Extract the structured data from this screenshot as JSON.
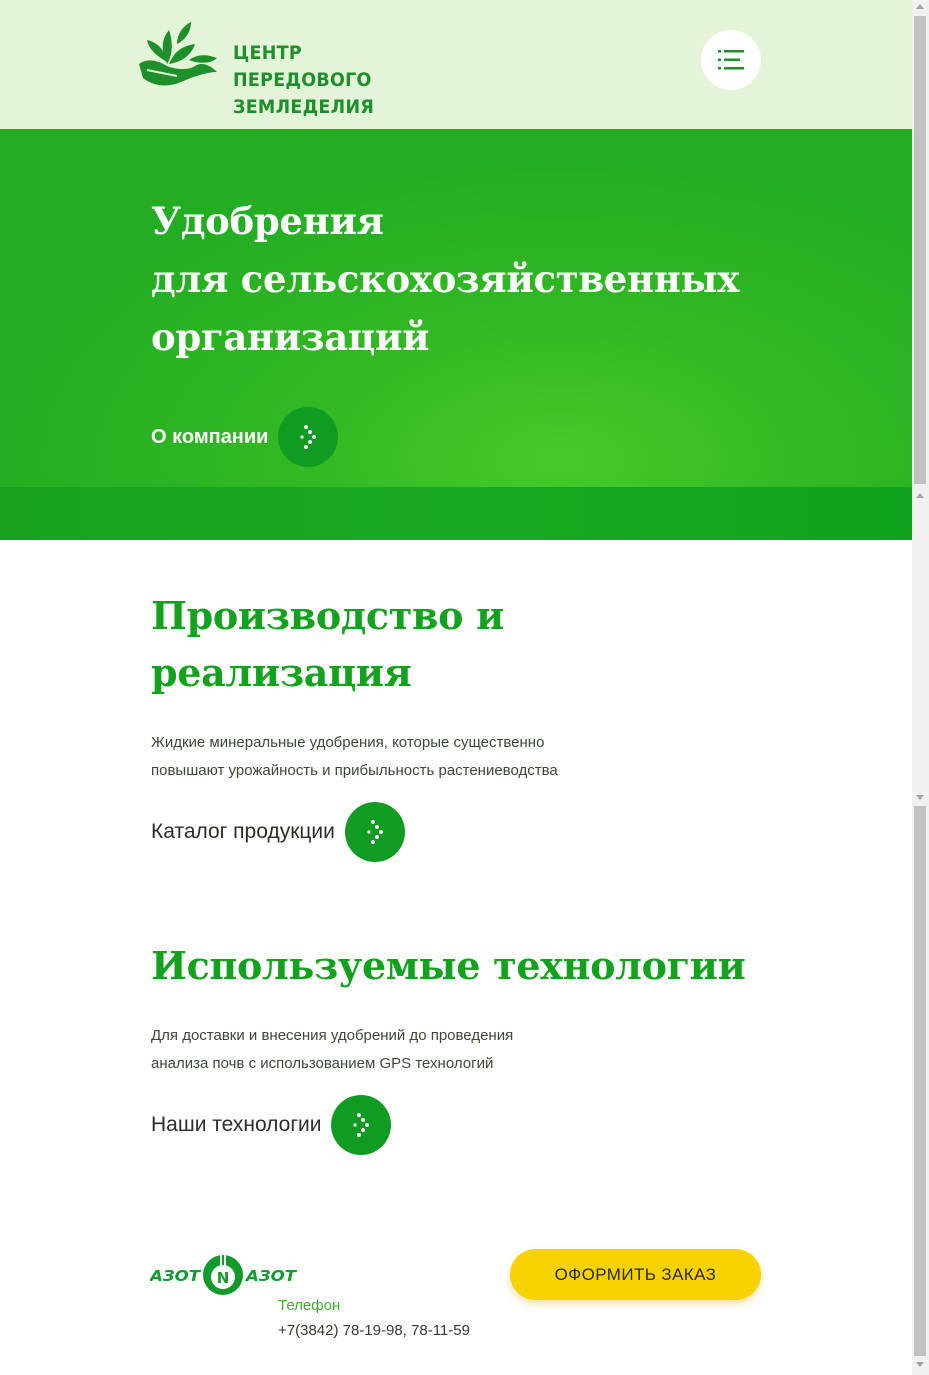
{
  "header": {
    "logo_line1": "ЦЕНТР ПЕРЕДОВОГО",
    "logo_line2": "ЗЕМЛЕДЕЛИЯ",
    "logo_icon": "leaves-hand-icon",
    "menu_icon": "menu-list-icon"
  },
  "hero": {
    "title_line1": "Удобрения",
    "title_line2": "для сельскохозяйственных",
    "title_line3": "организаций",
    "link_label": "О компании",
    "link_icon": "dotted-arrow-right-icon"
  },
  "sections": [
    {
      "title_line1": "Производство и",
      "title_line2": "реализация",
      "desc_line1": "Жидкие минеральные удобрения, которые существенно",
      "desc_line2": "повышают урожайность и прибыльность растениеводства",
      "link_label": "Каталог продукции"
    },
    {
      "title_line1": "Используемые технологии",
      "desc_line1": "Для доставки и внесения удобрений до проведения",
      "desc_line2": "анализа почв с использованием GPS технологий",
      "link_label": "Наши технологии"
    }
  ],
  "footer": {
    "partner_logo_text": "АЗОТ N АЗОТ",
    "order_button": "ОФОРМИТЬ ЗАКАЗ",
    "phone_label": "Телефон",
    "phone_value": "+7(3842) 78-19-98, 78-11-59"
  },
  "colors": {
    "header_bg": "#e3f4d8",
    "brand_green": "#13a21d",
    "hero_green": "#34b923",
    "button_green": "#109c23",
    "order_yellow": "#f6d200"
  }
}
